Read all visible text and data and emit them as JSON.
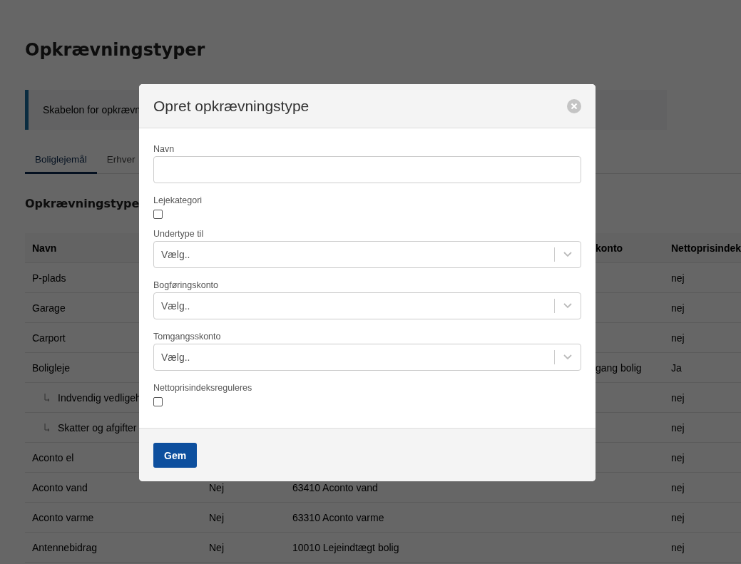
{
  "page": {
    "title": "Opkrævningstyper",
    "info": "Skabelon for opkrævn",
    "tabs": [
      {
        "label": "Boliglejemål",
        "selected": true
      },
      {
        "label": "Erhver",
        "selected": false
      }
    ],
    "section_title": "Opkrævningstype"
  },
  "table": {
    "columns": {
      "column_1": "Navn",
      "column_4": "konto",
      "column_5": "Nettoprisindek"
    },
    "rows": [
      {
        "name": "P-plads",
        "column_5": "nej"
      },
      {
        "name": "Garage",
        "column_5": "nej"
      },
      {
        "name": "Carport",
        "column_5": "nej"
      },
      {
        "name": "Boligleje",
        "column_4": "gang bolig",
        "column_5": "Ja",
        "children": [
          {
            "name": "Indvendig vedligeh",
            "column_5": "nej"
          },
          {
            "name": "Skatter og afgifter",
            "column_5": "nej"
          }
        ]
      },
      {
        "name": "Aconto el",
        "column_5": "nej"
      },
      {
        "name": "Aconto vand",
        "column_2": "Nej",
        "column_3": "63410 Aconto vand",
        "column_5": "nej"
      },
      {
        "name": "Aconto varme",
        "column_2": "Nej",
        "column_3": "63310 Aconto varme",
        "column_5": "nej"
      },
      {
        "name": "Antennebidrag",
        "column_2": "Nej",
        "column_3": "10010 Lejeindtægt bolig",
        "column_5": "nej"
      }
    ]
  },
  "modal": {
    "title": "Opret opkrævningstype",
    "fields": [
      {
        "kind": "text",
        "label": "Navn"
      },
      {
        "kind": "checkbox",
        "label": "Lejekategori",
        "checked": false
      },
      {
        "kind": "select",
        "label": "Undertype til",
        "placeholder": "Vælg.."
      },
      {
        "kind": "select",
        "label": "Bogføringskonto",
        "placeholder": "Vælg.."
      },
      {
        "kind": "select",
        "label": "Tomgangsskonto",
        "placeholder": "Vælg.."
      },
      {
        "kind": "checkbox",
        "label": "Nettoprisindeksreguleres",
        "checked": false
      }
    ],
    "buttons": [
      "Gem"
    ]
  }
}
